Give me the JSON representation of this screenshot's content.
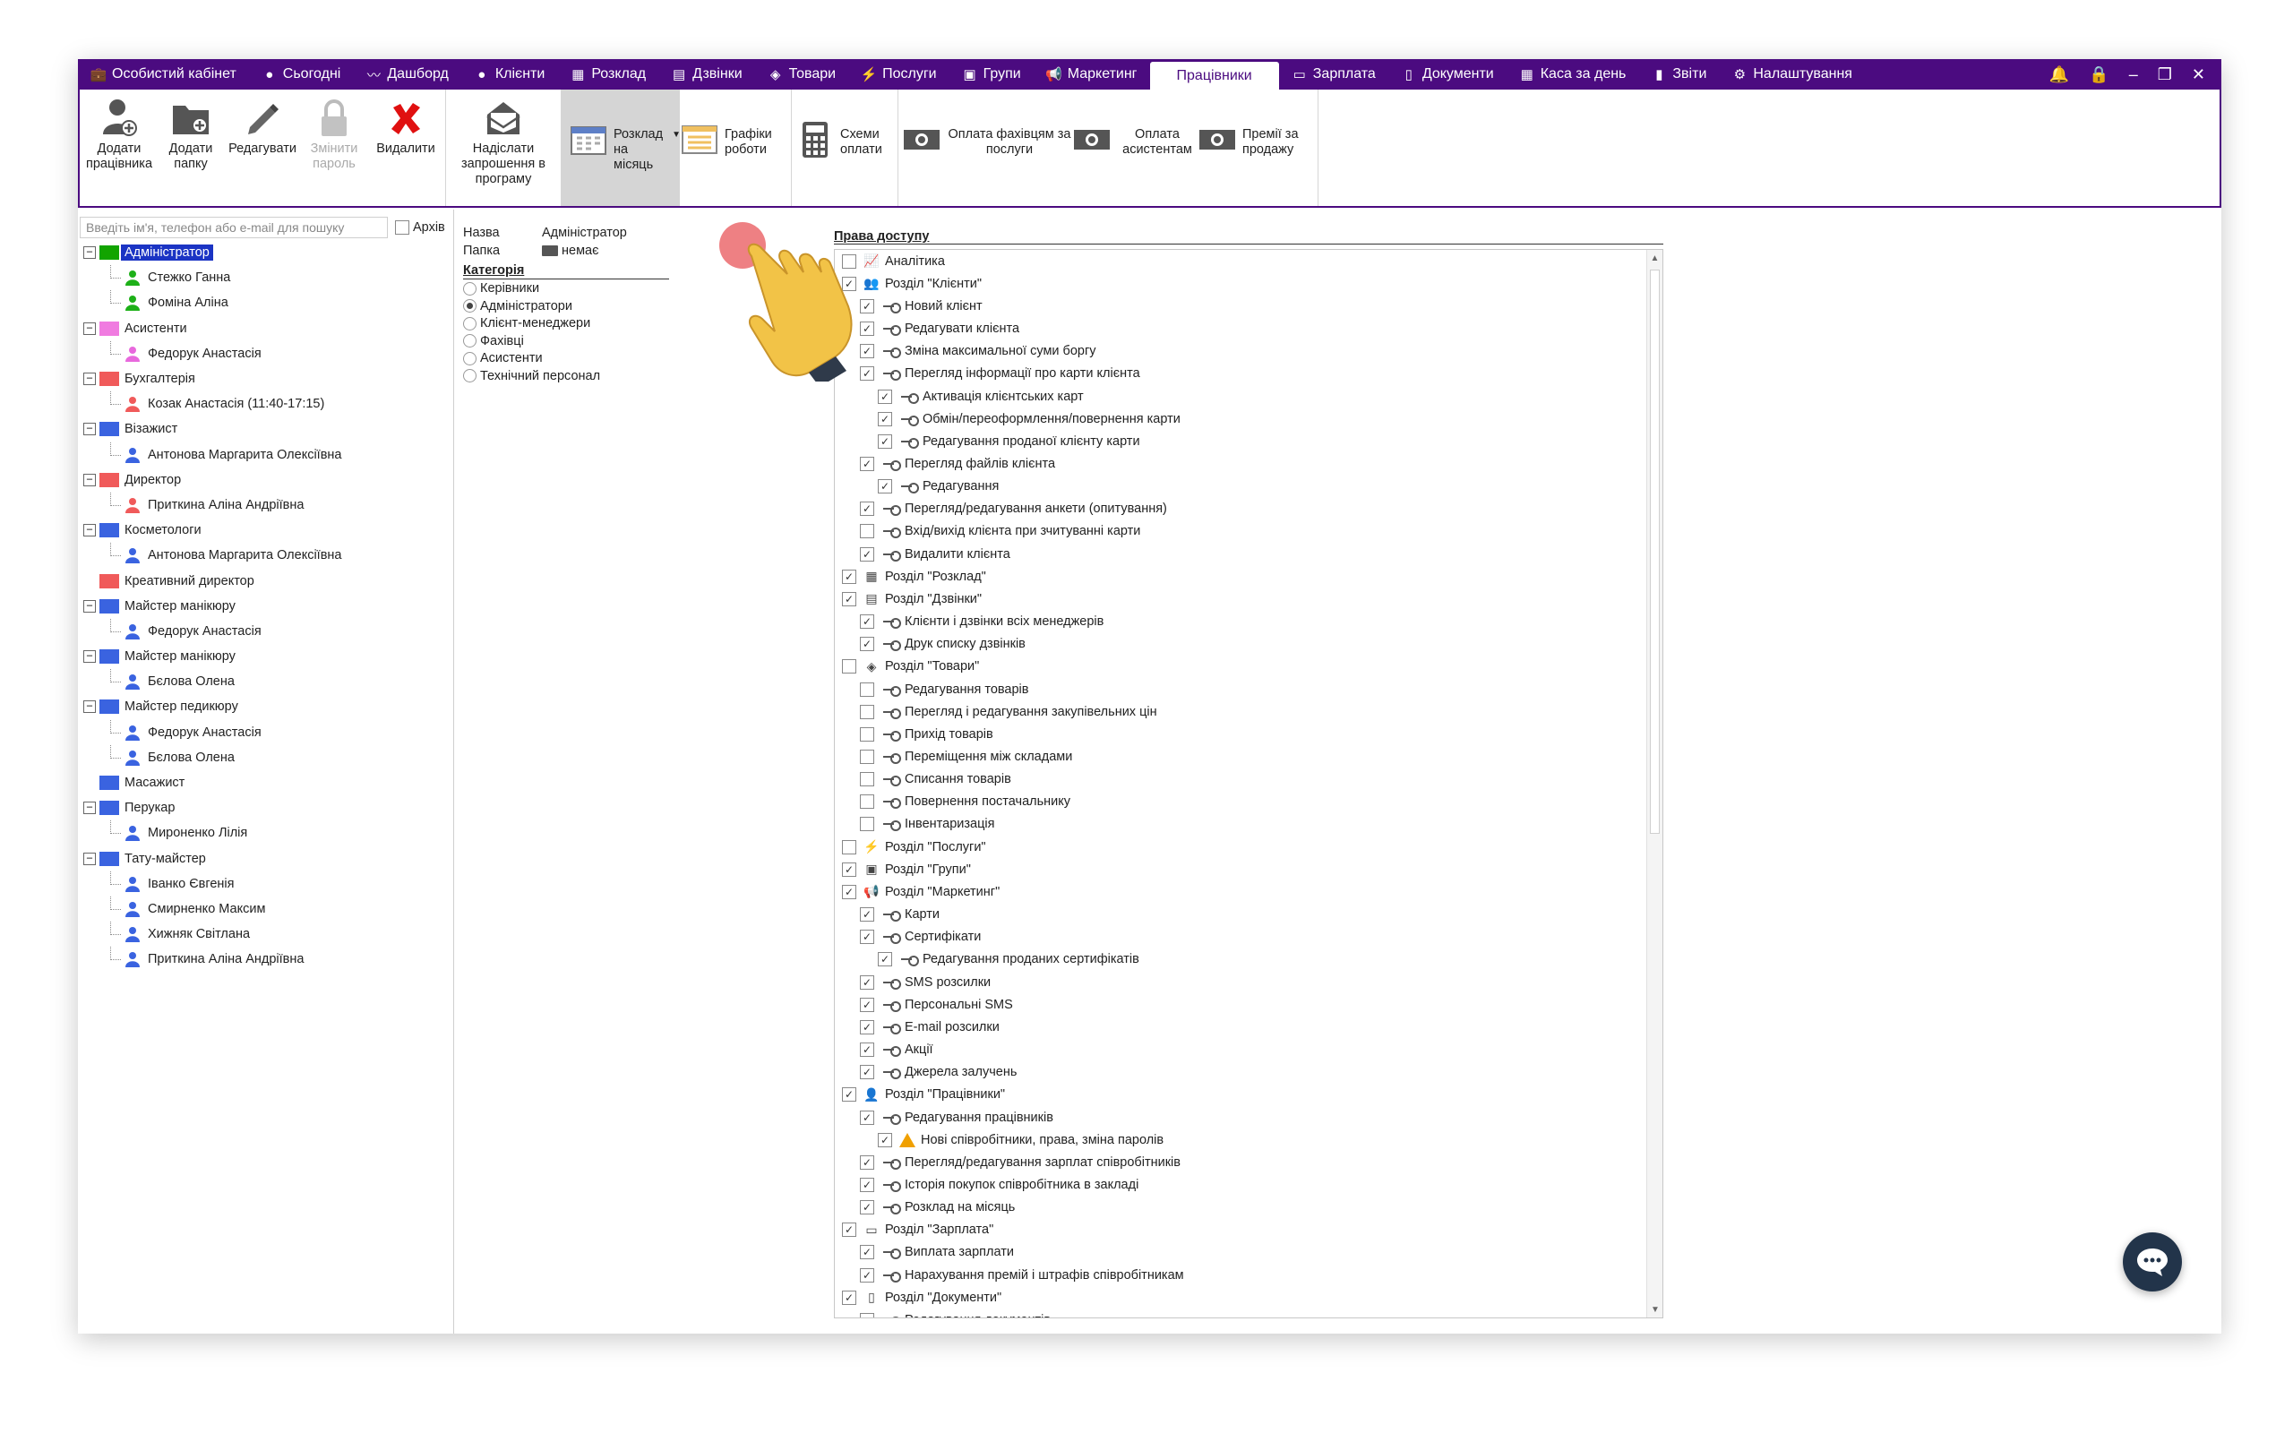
{
  "topnav": {
    "tabs": [
      {
        "icon": "briefcase-icon",
        "label": "Особистий кабінет"
      },
      {
        "icon": "today-icon",
        "label": "Сьогодні"
      },
      {
        "icon": "pulse-icon",
        "label": "Дашборд"
      },
      {
        "icon": "user-circle-icon",
        "label": "Клієнти"
      },
      {
        "icon": "calendar-icon",
        "label": "Розклад"
      },
      {
        "icon": "phone-list-icon",
        "label": "Дзвінки"
      },
      {
        "icon": "box-icon",
        "label": "Товари"
      },
      {
        "icon": "lightning-icon",
        "label": "Послуги"
      },
      {
        "icon": "group-icon",
        "label": "Групи"
      },
      {
        "icon": "megaphone-icon",
        "label": "Маркетинг"
      },
      {
        "icon": "",
        "label": "Працівники",
        "active": true
      },
      {
        "icon": "money-icon",
        "label": "Зарплата"
      },
      {
        "icon": "document-icon",
        "label": "Документи"
      },
      {
        "icon": "calculator-icon",
        "label": "Каса за день"
      },
      {
        "icon": "bar-chart-icon",
        "label": "Звіти"
      },
      {
        "icon": "gear-icon",
        "label": "Налаштування"
      }
    ],
    "window_controls": [
      "bell-icon",
      "lock-icon",
      "minimize-icon",
      "restore-icon",
      "close-icon"
    ]
  },
  "ribbon": {
    "add_employee": "Додати працівника",
    "add_folder": "Додати папку",
    "edit": "Редагувати",
    "change_password": "Змінити пароль",
    "delete": "Видалити",
    "send_invite": "Надіслати запрошення в програму",
    "schedule_month": "Розклад на місяць",
    "work_schedules": "Графіки роботи",
    "pay_schemes": "Схеми оплати",
    "pay_specialists": "Оплата фахівцям за послуги",
    "pay_assistants": "Оплата асистентам",
    "sales_bonuses": "Премії за продажу"
  },
  "search": {
    "placeholder": "Введіть ім'я, телефон або e-mail для пошуку",
    "archive_label": "Архів"
  },
  "tree": [
    {
      "type": "folder",
      "label": "Адміністратор",
      "color": "#12a400",
      "selected": true
    },
    {
      "type": "person",
      "label": "Стежко Ганна",
      "color": "#1db018"
    },
    {
      "type": "person",
      "label": "Фоміна Аліна",
      "color": "#1db018"
    },
    {
      "type": "folder",
      "label": "Асистенти",
      "color": "#f07be0"
    },
    {
      "type": "person",
      "label": "Федорук Анастасія",
      "color": "#e869dd"
    },
    {
      "type": "folder",
      "label": "Бухгалтерія",
      "color": "#f05a5a"
    },
    {
      "type": "person",
      "label": "Козак Анастасія (11:40-17:15)",
      "color": "#f05a5a"
    },
    {
      "type": "folder",
      "label": "Візажист",
      "color": "#3a63e0"
    },
    {
      "type": "person",
      "label": "Антонова Маргарита Олексіївна",
      "color": "#3a63e0"
    },
    {
      "type": "folder",
      "label": "Директор",
      "color": "#f05a5a"
    },
    {
      "type": "person",
      "label": "Приткина Аліна Андріївна",
      "color": "#f05a5a"
    },
    {
      "type": "folder",
      "label": "Косметологи",
      "color": "#3a63e0"
    },
    {
      "type": "person",
      "label": "Антонова Маргарита Олексіївна",
      "color": "#3a63e0"
    },
    {
      "type": "folder-leaf",
      "label": "Креативний директор",
      "color": "#f05a5a"
    },
    {
      "type": "folder",
      "label": "Майстер манікюру",
      "color": "#3a63e0"
    },
    {
      "type": "person",
      "label": "Федорук Анастасія",
      "color": "#3a63e0"
    },
    {
      "type": "folder",
      "label": "Майстер манікюру",
      "color": "#3a63e0"
    },
    {
      "type": "person",
      "label": "Бєлова Олена",
      "color": "#3a63e0"
    },
    {
      "type": "folder",
      "label": "Майстер педикюру",
      "color": "#3a63e0"
    },
    {
      "type": "person",
      "label": "Федорук Анастасія",
      "color": "#3a63e0"
    },
    {
      "type": "person",
      "label": "Бєлова Олена",
      "color": "#3a63e0"
    },
    {
      "type": "folder-leaf",
      "label": "Масажист",
      "color": "#3a63e0"
    },
    {
      "type": "folder",
      "label": "Перукар",
      "color": "#3a63e0"
    },
    {
      "type": "person",
      "label": "Мироненко Лілія",
      "color": "#3a63e0"
    },
    {
      "type": "folder",
      "label": "Тату-майстер",
      "color": "#3a63e0"
    },
    {
      "type": "person",
      "label": "Іванко Євгенія",
      "color": "#3a63e0"
    },
    {
      "type": "person",
      "label": "Смирненко Максим",
      "color": "#3a63e0"
    },
    {
      "type": "person",
      "label": "Хижняк Світлана",
      "color": "#3a63e0"
    },
    {
      "type": "person",
      "label": "Приткина Аліна Андріївна",
      "color": "#3a63e0"
    }
  ],
  "details": {
    "name_label": "Назва",
    "name_value": "Адміністратор",
    "folder_label": "Папка",
    "folder_value": "немає",
    "category_title": "Категорія",
    "categories": [
      {
        "label": "Керівники",
        "checked": false
      },
      {
        "label": "Адміністратори",
        "checked": true
      },
      {
        "label": "Клієнт-менеджери",
        "checked": false
      },
      {
        "label": "Фахівці",
        "checked": false
      },
      {
        "label": "Асистенти",
        "checked": false
      },
      {
        "label": "Технічний персонал",
        "checked": false
      }
    ]
  },
  "rights": {
    "title": "Права доступу",
    "items": [
      {
        "level": 0,
        "checked": false,
        "icon": "chart-icon",
        "label": "Аналітика"
      },
      {
        "level": 0,
        "checked": true,
        "icon": "clients-icon",
        "label": "Розділ \"Клієнти\""
      },
      {
        "level": 1,
        "checked": true,
        "icon": "key",
        "label": "Новий клієнт"
      },
      {
        "level": 1,
        "checked": true,
        "icon": "key",
        "label": "Редагувати клієнта"
      },
      {
        "level": 1,
        "checked": true,
        "icon": "key",
        "label": "Зміна максимальної суми боргу"
      },
      {
        "level": 1,
        "checked": true,
        "icon": "key",
        "label": "Перегляд інформації про карти клієнта"
      },
      {
        "level": 2,
        "checked": true,
        "icon": "key",
        "label": "Активація клієнтських карт"
      },
      {
        "level": 2,
        "checked": true,
        "icon": "key",
        "label": "Обмін/переоформлення/повернення карти"
      },
      {
        "level": 2,
        "checked": true,
        "icon": "key",
        "label": "Редагування проданої клієнту карти"
      },
      {
        "level": 1,
        "checked": true,
        "icon": "key",
        "label": "Перегляд файлів клієнта"
      },
      {
        "level": 2,
        "checked": true,
        "icon": "key",
        "label": "Редагування"
      },
      {
        "level": 1,
        "checked": true,
        "icon": "key",
        "label": "Перегляд/редагування анкети (опитування)"
      },
      {
        "level": 1,
        "checked": false,
        "icon": "key",
        "label": "Вхід/вихід клієнта при зчитуванні карти"
      },
      {
        "level": 1,
        "checked": true,
        "icon": "key",
        "label": "Видалити клієнта"
      },
      {
        "level": 0,
        "checked": true,
        "icon": "calendar-icon",
        "label": "Розділ \"Розклад\""
      },
      {
        "level": 0,
        "checked": true,
        "icon": "phone-list-icon",
        "label": "Розділ \"Дзвінки\""
      },
      {
        "level": 1,
        "checked": true,
        "icon": "key",
        "label": "Клієнти і дзвінки всіх менеджерів"
      },
      {
        "level": 1,
        "checked": true,
        "icon": "key",
        "label": "Друк списку дзвінків"
      },
      {
        "level": 0,
        "checked": false,
        "icon": "box-icon",
        "label": "Розділ \"Товари\""
      },
      {
        "level": 1,
        "checked": false,
        "icon": "key",
        "label": "Редагування товарів"
      },
      {
        "level": 1,
        "checked": false,
        "icon": "key",
        "label": "Перегляд і редагування закупівельних цін"
      },
      {
        "level": 1,
        "checked": false,
        "icon": "key",
        "label": "Прихід товарів"
      },
      {
        "level": 1,
        "checked": false,
        "icon": "key",
        "label": "Переміщення між складами"
      },
      {
        "level": 1,
        "checked": false,
        "icon": "key",
        "label": "Списання товарів"
      },
      {
        "level": 1,
        "checked": false,
        "icon": "key",
        "label": "Повернення постачальнику"
      },
      {
        "level": 1,
        "checked": false,
        "icon": "key",
        "label": "Інвентаризація"
      },
      {
        "level": 0,
        "checked": false,
        "icon": "lightning-icon",
        "label": "Розділ \"Послуги\""
      },
      {
        "level": 0,
        "checked": true,
        "icon": "group-icon",
        "label": "Розділ \"Групи\""
      },
      {
        "level": 0,
        "checked": true,
        "icon": "megaphone-icon",
        "label": "Розділ \"Маркетинг\""
      },
      {
        "level": 1,
        "checked": true,
        "icon": "key",
        "label": "Карти"
      },
      {
        "level": 1,
        "checked": true,
        "icon": "key",
        "label": "Сертифікати"
      },
      {
        "level": 2,
        "checked": true,
        "icon": "key",
        "label": "Редагування проданих сертифікатів"
      },
      {
        "level": 1,
        "checked": true,
        "icon": "key",
        "label": "SMS розсилки"
      },
      {
        "level": 1,
        "checked": true,
        "icon": "key",
        "label": "Персональні SMS"
      },
      {
        "level": 1,
        "checked": true,
        "icon": "key",
        "label": "E-mail розсилки"
      },
      {
        "level": 1,
        "checked": true,
        "icon": "key",
        "label": "Акції"
      },
      {
        "level": 1,
        "checked": true,
        "icon": "key",
        "label": "Джерела залучень"
      },
      {
        "level": 0,
        "checked": true,
        "icon": "person-icon",
        "label": "Розділ \"Працівники\""
      },
      {
        "level": 1,
        "checked": true,
        "icon": "key",
        "label": "Редагування працівників"
      },
      {
        "level": 2,
        "checked": true,
        "icon": "warning",
        "label": "Нові співробітники, права, зміна паролів"
      },
      {
        "level": 1,
        "checked": true,
        "icon": "key",
        "label": "Перегляд/редагування зарплат співробітників"
      },
      {
        "level": 1,
        "checked": true,
        "icon": "key",
        "label": "Історія покупок співробітника в закладі"
      },
      {
        "level": 1,
        "checked": true,
        "icon": "key",
        "label": "Розклад на місяць"
      },
      {
        "level": 0,
        "checked": true,
        "icon": "money-icon",
        "label": "Розділ \"Зарплата\""
      },
      {
        "level": 1,
        "checked": true,
        "icon": "key",
        "label": "Виплата зарплати"
      },
      {
        "level": 1,
        "checked": true,
        "icon": "key",
        "label": "Нарахування премій і штрафів співробітникам"
      },
      {
        "level": 0,
        "checked": true,
        "icon": "document-icon",
        "label": "Розділ \"Документи\""
      },
      {
        "level": 1,
        "checked": false,
        "icon": "key",
        "label": "Редагування документів"
      }
    ]
  },
  "colors": {
    "accent": "#4b0b80",
    "selection": "#1b34c4",
    "chat": "#22344a"
  }
}
